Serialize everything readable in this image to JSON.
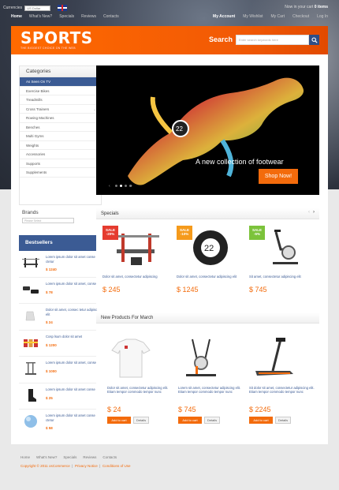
{
  "topbar": {
    "currencies_label": "Currencies",
    "currency_value": "US Dollar",
    "cart_label": "Now in your cart",
    "cart_value": "0 items",
    "nav": [
      "Home",
      "What's New?",
      "Specials",
      "Reviews",
      "Contacts"
    ],
    "account_nav": [
      "My Account",
      "My Wishlist",
      "My Cart",
      "Checkout",
      "Log In"
    ]
  },
  "header": {
    "logo": "SPORTS",
    "tagline": "THE BIGGEST CHOICE ON THE WEB",
    "search_label": "Search",
    "search_placeholder": "Enter search keywords here"
  },
  "categories": {
    "title": "Categories",
    "items": [
      "As Seen On TV",
      "Exercise Bikes",
      "Treadmills",
      "Cross Trainers",
      "Rowing Machines",
      "Benches",
      "Multi Gyms",
      "Weights",
      "Accessories",
      "Supports",
      "Supplements"
    ]
  },
  "brands": {
    "title": "Brands",
    "placeholder": "Please Select"
  },
  "bestsellers": {
    "title": "Bestsellers",
    "items": [
      {
        "text": "Lorem ipsum dolor sit amet conse ctetur",
        "price": "$ 1240"
      },
      {
        "text": "Lorem ipsum dolor sit amet, conse",
        "price": "$ 78"
      },
      {
        "text": "Dolor sit amet, consec tetur adipisc elit",
        "price": "$ 24"
      },
      {
        "text": "Cosp lsum dolor sit amet",
        "price": "$ 1200"
      },
      {
        "text": "Lorem ipsum dolor sit amet, conse",
        "price": "$ 1000"
      },
      {
        "text": "Lorem ipsum dolor sit amet conse",
        "price": "$ 25"
      },
      {
        "text": "Lorem ipsum dolor sit amet conse ctetur",
        "price": "$ 58"
      }
    ]
  },
  "slider": {
    "caption": "A new collection of footwear",
    "button": "Shop Now!"
  },
  "specials": {
    "title": "Specials",
    "items": [
      {
        "badge": "SALE -20%",
        "text": "Dolor sit amet, consectetur adipiscing",
        "price": "$ 245"
      },
      {
        "badge": "SALE -10%",
        "text": "Dolor sit amet, consectetur adipiscing elit",
        "price": "$ 1245"
      },
      {
        "badge": "SALE -5%",
        "text": "Sit amet, consectetur adipiscing elit",
        "price": "$ 745"
      }
    ]
  },
  "new_products": {
    "title": "New Products For March",
    "add_label": "Add to cart",
    "details_label": "Details",
    "items": [
      {
        "text": "Dolor sit amet, consectetur adipiscing elit. Etiam tempor commodo tempor nunc",
        "price": "$ 24"
      },
      {
        "text": "Lorem sit amet, consectetur adipiscing elit. Etiam tempor commodo tempor nunc",
        "price": "$ 745"
      },
      {
        "text": "Sit dolor sit amet, consectetur adipiscing elit. Etiam tempor commodo tempor nunc",
        "price": "$ 2245"
      }
    ]
  },
  "footer": {
    "nav": [
      "Home",
      "What's New?",
      "Specials",
      "Reviews",
      "Contacts"
    ],
    "copyright": "Copyright © 2011 osCommerce",
    "privacy": "Privacy Notice",
    "conditions": "Conditions of Use"
  },
  "colors": {
    "accent": "#f36b0c",
    "nav_blue": "#3b5b94",
    "sale_red": "#e53b2f",
    "sale_orange": "#f59a1b",
    "sale_green": "#7cc33b"
  }
}
